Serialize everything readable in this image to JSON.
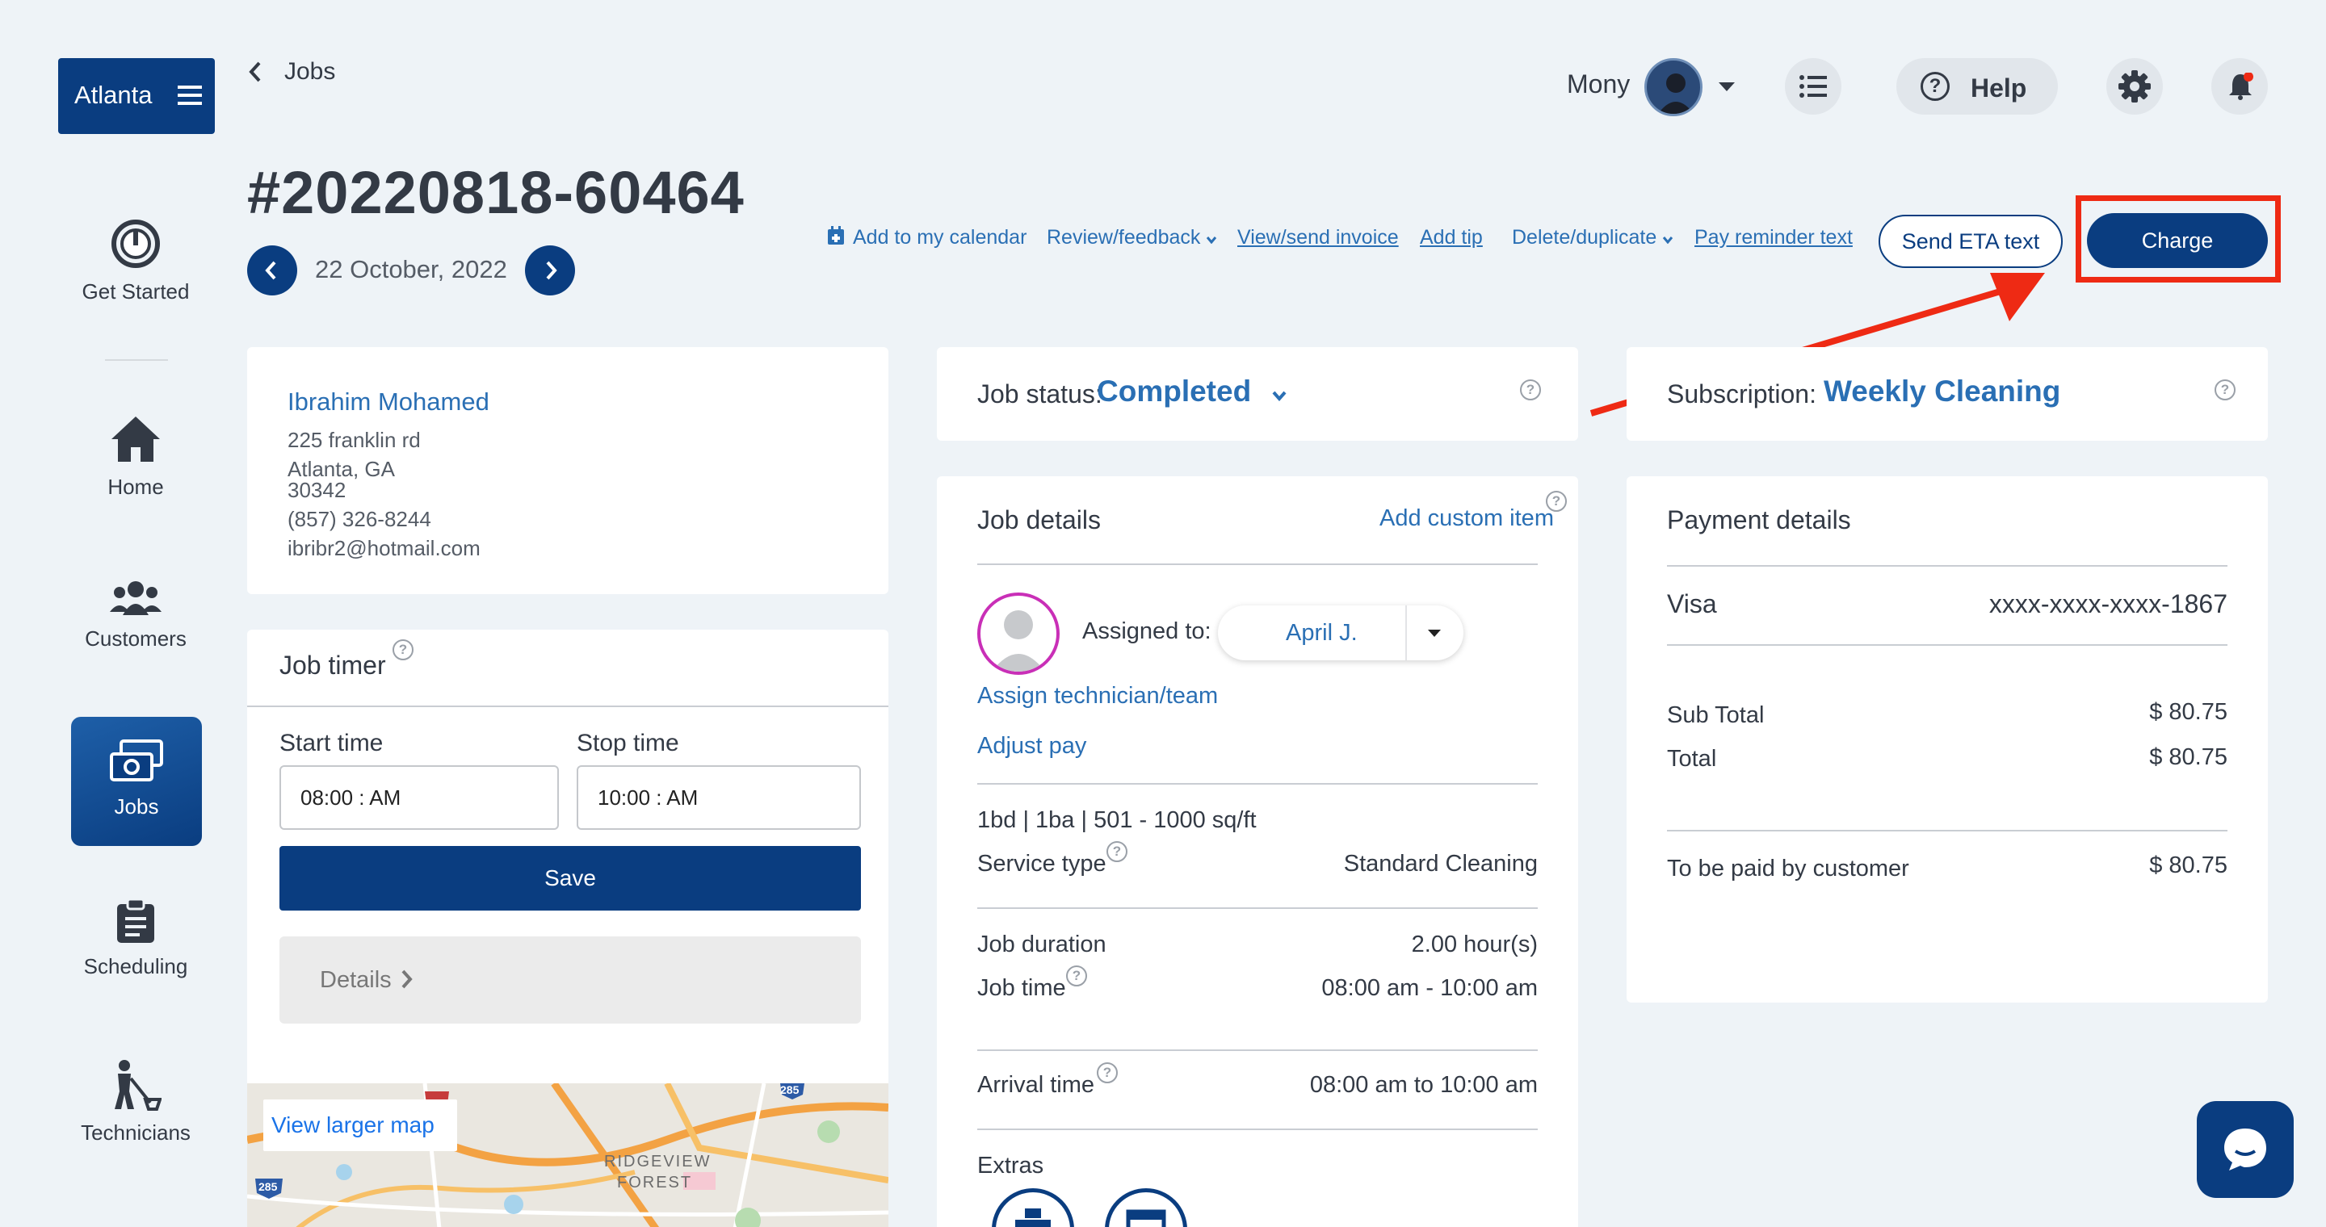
{
  "location_button": {
    "label": "Atlanta"
  },
  "breadcrumb": {
    "label": "Jobs"
  },
  "header": {
    "user_name": "Mony",
    "help_label": "Help"
  },
  "sidebar": {
    "items": [
      {
        "label": "Get Started"
      },
      {
        "label": "Home"
      },
      {
        "label": "Customers"
      },
      {
        "label": "Jobs"
      },
      {
        "label": "Scheduling"
      },
      {
        "label": "Technicians"
      }
    ]
  },
  "job": {
    "number": "#20220818-60464",
    "date": "22 October, 2022"
  },
  "actions": {
    "add_calendar": "Add to my calendar",
    "review_feedback": "Review/feedback",
    "view_invoice": "View/send invoice",
    "add_tip": "Add tip",
    "delete_duplicate": "Delete/duplicate",
    "pay_reminder": "Pay reminder text",
    "send_eta": "Send ETA text",
    "charge": "Charge"
  },
  "customer": {
    "name": "Ibrahim Mohamed",
    "street": "225 franklin rd",
    "city": "Atlanta, GA",
    "zip": "30342",
    "phone": "(857) 326-8244",
    "email": "ibribr2@hotmail.com"
  },
  "timer": {
    "title": "Job timer",
    "start_label": "Start time",
    "stop_label": "Stop time",
    "start_value": "08:00 : AM",
    "stop_value": "10:00 : AM",
    "save_label": "Save",
    "details_label": "Details"
  },
  "map": {
    "view_larger": "View larger map",
    "area_label_1": "RIDGEVIEW",
    "area_label_2": "FOREST",
    "shield_1": "285",
    "shield_2": "285"
  },
  "status": {
    "label": "Job status:",
    "value": "Completed"
  },
  "job_details": {
    "title": "Job details",
    "add_custom": "Add custom item",
    "assigned_label": "Assigned to:",
    "assigned_value": "April J.",
    "assign_tech": "Assign technician/team",
    "adjust_pay": "Adjust pay",
    "size": "1bd | 1ba | 501 - 1000 sq/ft",
    "service_type_label": "Service type",
    "service_type_value": "Standard Cleaning",
    "duration_label": "Job duration",
    "duration_value": "2.00 hour(s)",
    "time_label": "Job time",
    "time_value": "08:00 am - 10:00 am",
    "arrival_label": "Arrival time",
    "arrival_value": "08:00 am to 10:00 am",
    "extras_label": "Extras"
  },
  "subscription": {
    "label": "Subscription:",
    "value": "Weekly Cleaning"
  },
  "payment": {
    "title": "Payment details",
    "card_type": "Visa",
    "card_number": "xxxx-xxxx-xxxx-1867",
    "subtotal_label": "Sub Total",
    "subtotal_value": "$ 80.75",
    "total_label": "Total",
    "total_value": "$ 80.75",
    "paid_by_label": "To be paid by customer",
    "paid_by_value": "$ 80.75"
  },
  "colors": {
    "navy": "#0a3d80",
    "link": "#2a6fb4",
    "annotation_red": "#ee2a14",
    "background": "#eef3f7"
  }
}
